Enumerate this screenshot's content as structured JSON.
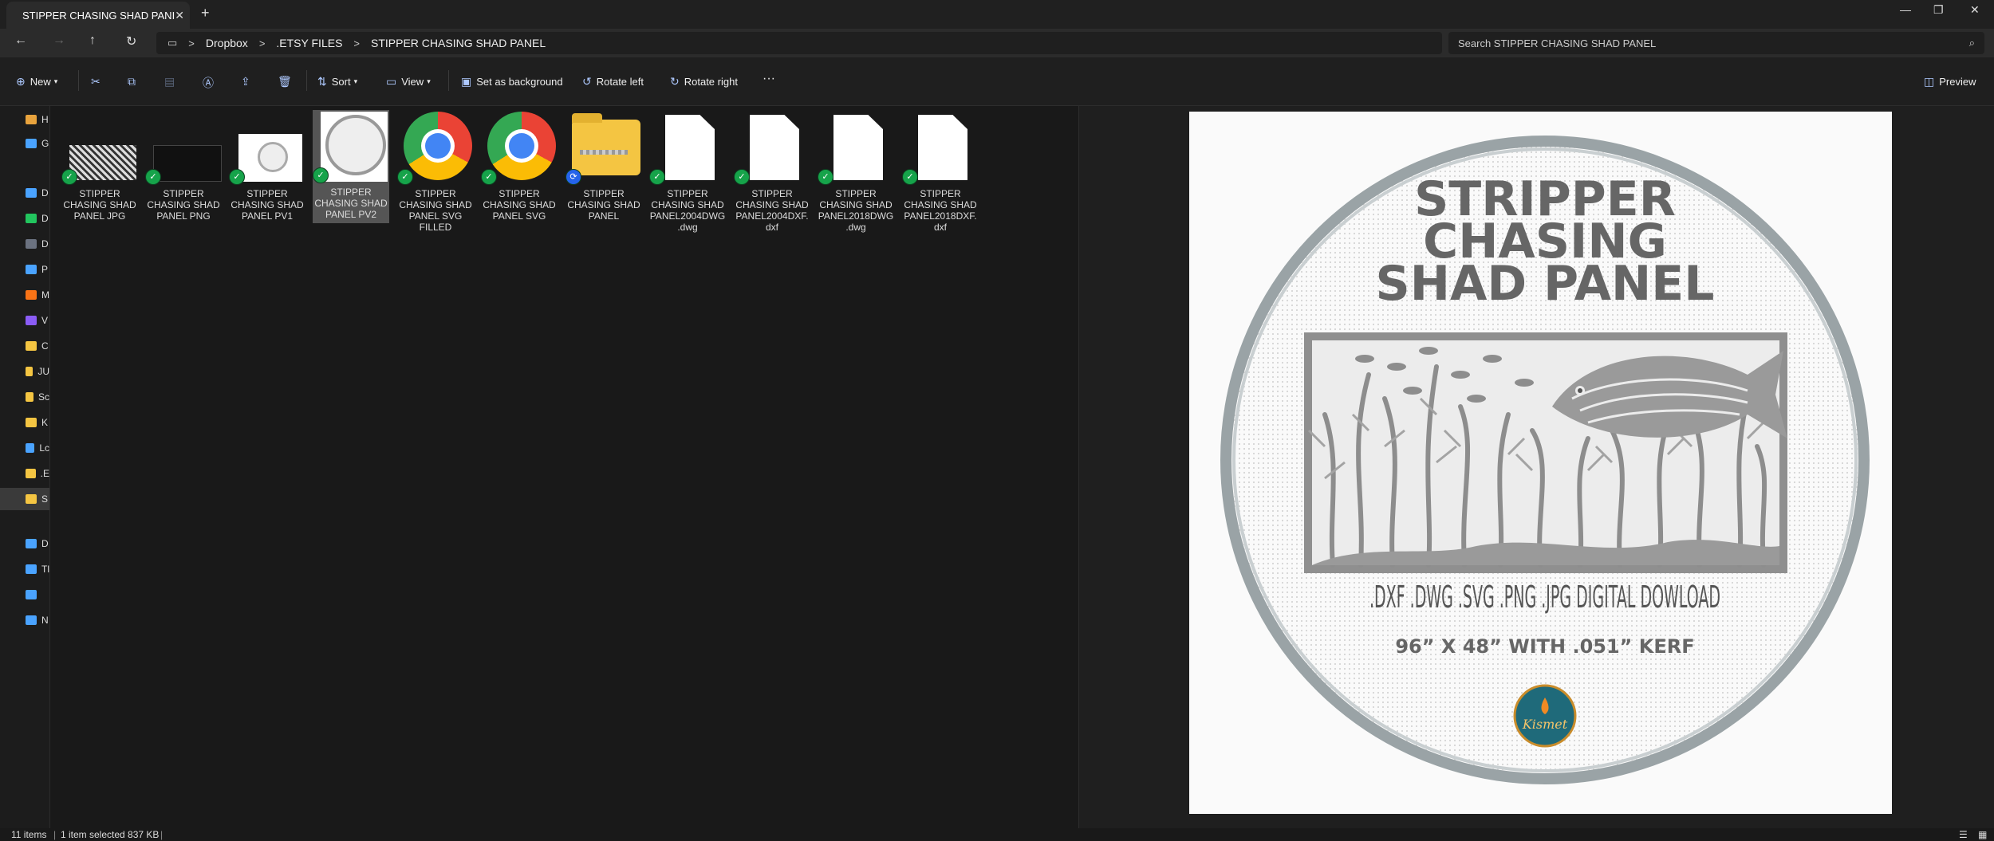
{
  "window": {
    "tab_title": "STIPPER CHASING SHAD PANI",
    "tab_close": "✕",
    "new_tab": "+",
    "min": "—",
    "max": "❐",
    "close": "✕"
  },
  "address": {
    "crumbs": [
      "Dropbox",
      ".ETSY FILES",
      "STIPPER CHASING SHAD PANEL"
    ],
    "sep": ">",
    "search_placeholder": "Search STIPPER CHASING SHAD PANEL"
  },
  "toolbar": {
    "new": "New",
    "sort": "Sort",
    "view": "View",
    "set_bg": "Set as background",
    "rotate_left": "Rotate left",
    "rotate_right": "Rotate right",
    "more": "···",
    "preview": "Preview"
  },
  "nav": [
    {
      "label": "H",
      "color": "#e8a33d"
    },
    {
      "label": "G",
      "color": "#4aa3ff"
    },
    {
      "label": "D",
      "color": "#4aa3ff"
    },
    {
      "label": "D",
      "color": "#22c55e"
    },
    {
      "label": "D",
      "color": "#6b7280"
    },
    {
      "label": "P",
      "color": "#4aa3ff"
    },
    {
      "label": "M",
      "color": "#f97316"
    },
    {
      "label": "V",
      "color": "#8b5cf6"
    },
    {
      "label": "C",
      "color": "#f4c542"
    },
    {
      "label": "JU",
      "color": "#f4c542"
    },
    {
      "label": "Sc",
      "color": "#f4c542"
    },
    {
      "label": "K",
      "color": "#f4c542"
    },
    {
      "label": "Lc",
      "color": "#4aa3ff"
    },
    {
      "label": ".E",
      "color": "#f4c542"
    },
    {
      "label": "S",
      "color": "#f4c542"
    },
    {
      "label": "D",
      "color": "#4aa3ff"
    },
    {
      "label": "Tl",
      "color": "#4aa3ff"
    },
    {
      "label": "",
      "color": "#4aa3ff"
    },
    {
      "label": "N",
      "color": "#4aa3ff"
    }
  ],
  "files": [
    {
      "name": "STIPPER CHASING SHAD PANEL JPG",
      "kind": "img-dark"
    },
    {
      "name": "STIPPER CHASING SHAD PANEL PNG",
      "kind": "img-black"
    },
    {
      "name": "STIPPER CHASING SHAD PANEL PV1",
      "kind": "img-white"
    },
    {
      "name": "STIPPER CHASING SHAD PANEL PV2",
      "kind": "img-white2"
    },
    {
      "name": "STIPPER CHASING SHAD PANEL SVG FILLED",
      "kind": "chrome"
    },
    {
      "name": "STIPPER CHASING SHAD PANEL SVG",
      "kind": "chrome"
    },
    {
      "name": "STIPPER CHASING SHAD PANEL",
      "kind": "zip"
    },
    {
      "name": "STIPPER CHASING SHAD PANEL2004DWG.dwg",
      "kind": "doc"
    },
    {
      "name": "STIPPER CHASING SHAD PANEL2004DXF.dxf",
      "kind": "doc"
    },
    {
      "name": "STIPPER CHASING SHAD PANEL2018DWG.dwg",
      "kind": "doc"
    },
    {
      "name": "STIPPER CHASING SHAD PANEL2018DXF.dxf",
      "kind": "doc"
    }
  ],
  "preview": {
    "title1": "STRIPPER",
    "title2": "CHASING",
    "title3": "SHAD PANEL",
    "formats": ".DXF .DWG .SVG .PNG .JPG DIGITAL DOWLOAD",
    "size": "96” X 48” WITH .051” KERF",
    "logo": "Kismet"
  },
  "status": {
    "items": "11 items",
    "selected": "1 item selected  837 KB"
  }
}
